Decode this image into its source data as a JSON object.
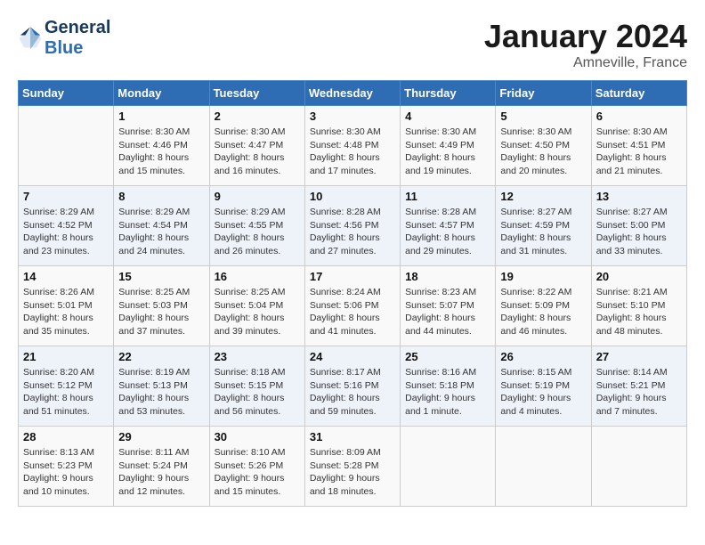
{
  "header": {
    "logo_line1": "General",
    "logo_line2": "Blue",
    "month": "January 2024",
    "location": "Amneville, France"
  },
  "days_of_week": [
    "Sunday",
    "Monday",
    "Tuesday",
    "Wednesday",
    "Thursday",
    "Friday",
    "Saturday"
  ],
  "weeks": [
    [
      {
        "day": "",
        "sunrise": "",
        "sunset": "",
        "daylight": ""
      },
      {
        "day": "1",
        "sunrise": "Sunrise: 8:30 AM",
        "sunset": "Sunset: 4:46 PM",
        "daylight": "Daylight: 8 hours and 15 minutes."
      },
      {
        "day": "2",
        "sunrise": "Sunrise: 8:30 AM",
        "sunset": "Sunset: 4:47 PM",
        "daylight": "Daylight: 8 hours and 16 minutes."
      },
      {
        "day": "3",
        "sunrise": "Sunrise: 8:30 AM",
        "sunset": "Sunset: 4:48 PM",
        "daylight": "Daylight: 8 hours and 17 minutes."
      },
      {
        "day": "4",
        "sunrise": "Sunrise: 8:30 AM",
        "sunset": "Sunset: 4:49 PM",
        "daylight": "Daylight: 8 hours and 19 minutes."
      },
      {
        "day": "5",
        "sunrise": "Sunrise: 8:30 AM",
        "sunset": "Sunset: 4:50 PM",
        "daylight": "Daylight: 8 hours and 20 minutes."
      },
      {
        "day": "6",
        "sunrise": "Sunrise: 8:30 AM",
        "sunset": "Sunset: 4:51 PM",
        "daylight": "Daylight: 8 hours and 21 minutes."
      }
    ],
    [
      {
        "day": "7",
        "sunrise": "Sunrise: 8:29 AM",
        "sunset": "Sunset: 4:52 PM",
        "daylight": "Daylight: 8 hours and 23 minutes."
      },
      {
        "day": "8",
        "sunrise": "Sunrise: 8:29 AM",
        "sunset": "Sunset: 4:54 PM",
        "daylight": "Daylight: 8 hours and 24 minutes."
      },
      {
        "day": "9",
        "sunrise": "Sunrise: 8:29 AM",
        "sunset": "Sunset: 4:55 PM",
        "daylight": "Daylight: 8 hours and 26 minutes."
      },
      {
        "day": "10",
        "sunrise": "Sunrise: 8:28 AM",
        "sunset": "Sunset: 4:56 PM",
        "daylight": "Daylight: 8 hours and 27 minutes."
      },
      {
        "day": "11",
        "sunrise": "Sunrise: 8:28 AM",
        "sunset": "Sunset: 4:57 PM",
        "daylight": "Daylight: 8 hours and 29 minutes."
      },
      {
        "day": "12",
        "sunrise": "Sunrise: 8:27 AM",
        "sunset": "Sunset: 4:59 PM",
        "daylight": "Daylight: 8 hours and 31 minutes."
      },
      {
        "day": "13",
        "sunrise": "Sunrise: 8:27 AM",
        "sunset": "Sunset: 5:00 PM",
        "daylight": "Daylight: 8 hours and 33 minutes."
      }
    ],
    [
      {
        "day": "14",
        "sunrise": "Sunrise: 8:26 AM",
        "sunset": "Sunset: 5:01 PM",
        "daylight": "Daylight: 8 hours and 35 minutes."
      },
      {
        "day": "15",
        "sunrise": "Sunrise: 8:25 AM",
        "sunset": "Sunset: 5:03 PM",
        "daylight": "Daylight: 8 hours and 37 minutes."
      },
      {
        "day": "16",
        "sunrise": "Sunrise: 8:25 AM",
        "sunset": "Sunset: 5:04 PM",
        "daylight": "Daylight: 8 hours and 39 minutes."
      },
      {
        "day": "17",
        "sunrise": "Sunrise: 8:24 AM",
        "sunset": "Sunset: 5:06 PM",
        "daylight": "Daylight: 8 hours and 41 minutes."
      },
      {
        "day": "18",
        "sunrise": "Sunrise: 8:23 AM",
        "sunset": "Sunset: 5:07 PM",
        "daylight": "Daylight: 8 hours and 44 minutes."
      },
      {
        "day": "19",
        "sunrise": "Sunrise: 8:22 AM",
        "sunset": "Sunset: 5:09 PM",
        "daylight": "Daylight: 8 hours and 46 minutes."
      },
      {
        "day": "20",
        "sunrise": "Sunrise: 8:21 AM",
        "sunset": "Sunset: 5:10 PM",
        "daylight": "Daylight: 8 hours and 48 minutes."
      }
    ],
    [
      {
        "day": "21",
        "sunrise": "Sunrise: 8:20 AM",
        "sunset": "Sunset: 5:12 PM",
        "daylight": "Daylight: 8 hours and 51 minutes."
      },
      {
        "day": "22",
        "sunrise": "Sunrise: 8:19 AM",
        "sunset": "Sunset: 5:13 PM",
        "daylight": "Daylight: 8 hours and 53 minutes."
      },
      {
        "day": "23",
        "sunrise": "Sunrise: 8:18 AM",
        "sunset": "Sunset: 5:15 PM",
        "daylight": "Daylight: 8 hours and 56 minutes."
      },
      {
        "day": "24",
        "sunrise": "Sunrise: 8:17 AM",
        "sunset": "Sunset: 5:16 PM",
        "daylight": "Daylight: 8 hours and 59 minutes."
      },
      {
        "day": "25",
        "sunrise": "Sunrise: 8:16 AM",
        "sunset": "Sunset: 5:18 PM",
        "daylight": "Daylight: 9 hours and 1 minute."
      },
      {
        "day": "26",
        "sunrise": "Sunrise: 8:15 AM",
        "sunset": "Sunset: 5:19 PM",
        "daylight": "Daylight: 9 hours and 4 minutes."
      },
      {
        "day": "27",
        "sunrise": "Sunrise: 8:14 AM",
        "sunset": "Sunset: 5:21 PM",
        "daylight": "Daylight: 9 hours and 7 minutes."
      }
    ],
    [
      {
        "day": "28",
        "sunrise": "Sunrise: 8:13 AM",
        "sunset": "Sunset: 5:23 PM",
        "daylight": "Daylight: 9 hours and 10 minutes."
      },
      {
        "day": "29",
        "sunrise": "Sunrise: 8:11 AM",
        "sunset": "Sunset: 5:24 PM",
        "daylight": "Daylight: 9 hours and 12 minutes."
      },
      {
        "day": "30",
        "sunrise": "Sunrise: 8:10 AM",
        "sunset": "Sunset: 5:26 PM",
        "daylight": "Daylight: 9 hours and 15 minutes."
      },
      {
        "day": "31",
        "sunrise": "Sunrise: 8:09 AM",
        "sunset": "Sunset: 5:28 PM",
        "daylight": "Daylight: 9 hours and 18 minutes."
      },
      {
        "day": "",
        "sunrise": "",
        "sunset": "",
        "daylight": ""
      },
      {
        "day": "",
        "sunrise": "",
        "sunset": "",
        "daylight": ""
      },
      {
        "day": "",
        "sunrise": "",
        "sunset": "",
        "daylight": ""
      }
    ]
  ]
}
